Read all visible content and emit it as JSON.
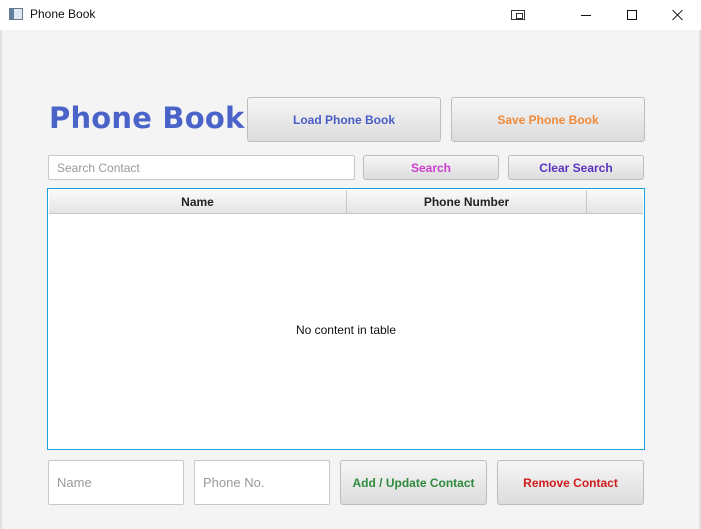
{
  "window": {
    "title": "Phone Book",
    "controls": {
      "special_icon": "window-snap-icon",
      "minimize_icon": "minimize-icon",
      "maximize_icon": "maximize-icon",
      "close_icon": "close-icon"
    }
  },
  "header": {
    "title": "Phone Book",
    "title_color": "#4a63c9"
  },
  "toolbar": {
    "load_label": "Load Phone Book",
    "save_label": "Save Phone Book"
  },
  "search": {
    "placeholder": "Search Contact",
    "value": "",
    "search_label": "Search",
    "clear_label": "Clear Search"
  },
  "table": {
    "columns": [
      "Name",
      "Phone Number"
    ],
    "rows": [],
    "empty_message": "No content in table",
    "border_color": "#1ba1e2"
  },
  "form": {
    "name_placeholder": "Name",
    "name_value": "",
    "phone_placeholder": "Phone No.",
    "phone_value": "",
    "add_label": "Add / Update Contact",
    "remove_label": "Remove Contact"
  },
  "colors": {
    "load": "#4a5cc7",
    "save": "#f08a3a",
    "search": "#cc3fd1",
    "clear": "#5a35c4",
    "add": "#2e8a3e",
    "remove": "#cf1b1b"
  }
}
